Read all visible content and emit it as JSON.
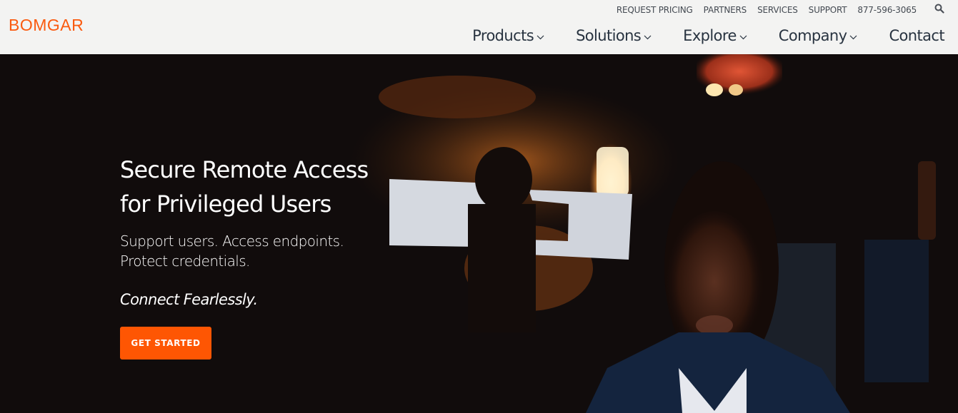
{
  "header": {
    "logo": "BOMGAR",
    "utility_nav": [
      "REQUEST PRICING",
      "PARTNERS",
      "SERVICES",
      "SUPPORT",
      "877-596-3065"
    ],
    "search_icon": "search-icon",
    "main_nav": [
      {
        "label": "Products",
        "has_dropdown": true
      },
      {
        "label": "Solutions",
        "has_dropdown": true
      },
      {
        "label": "Explore",
        "has_dropdown": true
      },
      {
        "label": "Company",
        "has_dropdown": true
      },
      {
        "label": "Contact",
        "has_dropdown": false
      }
    ]
  },
  "hero": {
    "headline_line1": "Secure Remote Access",
    "headline_line2": "for Privileged Users",
    "subhead_line1": "Support users. Access endpoints.",
    "subhead_line2": "Protect credentials.",
    "tagline": "Connect Fearlessly.",
    "cta_label": "GET STARTED"
  },
  "colors": {
    "brand_orange": "#fa5a0f",
    "cta_orange": "#fe5603",
    "header_bg": "#f3f3f2",
    "nav_text": "#283340",
    "hero_bg": "#110c0c"
  }
}
